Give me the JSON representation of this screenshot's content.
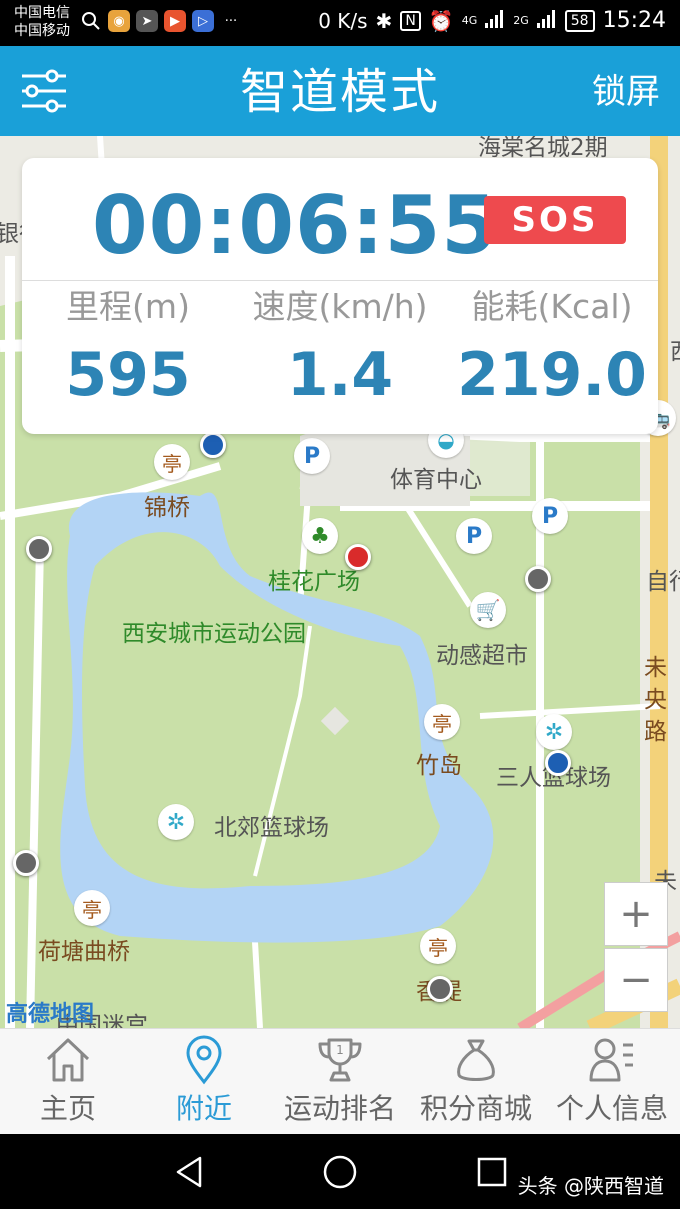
{
  "status_bar": {
    "carrier_1": "中国电信",
    "carrier_2": "中国移动",
    "speed": "0 K/s",
    "net_1": "4G",
    "net_2": "2G",
    "battery": "58",
    "time": "15:24"
  },
  "app_bar": {
    "title": "智道模式",
    "lock_label": "锁屏"
  },
  "stats": {
    "timer": "00:06:55",
    "sos_label": "SOS",
    "items": [
      {
        "label": "里程(m)",
        "value": "595"
      },
      {
        "label": "速度(km/h)",
        "value": "1.4"
      },
      {
        "label": "能耗(Kcal)",
        "value": "219.0"
      }
    ]
  },
  "map": {
    "labels": {
      "top_road": "海棠名城2期",
      "sports_center": "体育中心",
      "jinqiao": "锦桥",
      "guihua_square": "桂花广场",
      "park": "西安城市运动公园",
      "supermarket": "动感超市",
      "zhudao": "竹岛",
      "three_basket": "三人篮球场",
      "north_basket": "北郊篮球场",
      "hetang": "荷塘曲桥",
      "weiyang_road": "未央路",
      "xiangdi": "香堤",
      "bottom_partial": "中国迷宫",
      "left_partial": "银行",
      "right_partial_1": "西",
      "right_partial_2": "自行",
      "right_partial_3": "未"
    },
    "logo": "高德地图",
    "zoom_in": "+",
    "zoom_out": "−",
    "colors": {
      "water": "#b3d4f5",
      "grass": "#c9e0a8",
      "road": "#ffffff",
      "main_road": "#f3d27a"
    }
  },
  "bottom_nav": {
    "items": [
      {
        "label": "主页",
        "icon": "home-icon"
      },
      {
        "label": "附近",
        "icon": "location-pin-icon"
      },
      {
        "label": "运动排名",
        "icon": "trophy-icon"
      },
      {
        "label": "积分商城",
        "icon": "money-bag-icon"
      },
      {
        "label": "个人信息",
        "icon": "user-list-icon"
      }
    ],
    "active_index": 1
  },
  "system_nav": {
    "watermark": "头条 @陕西智道"
  }
}
